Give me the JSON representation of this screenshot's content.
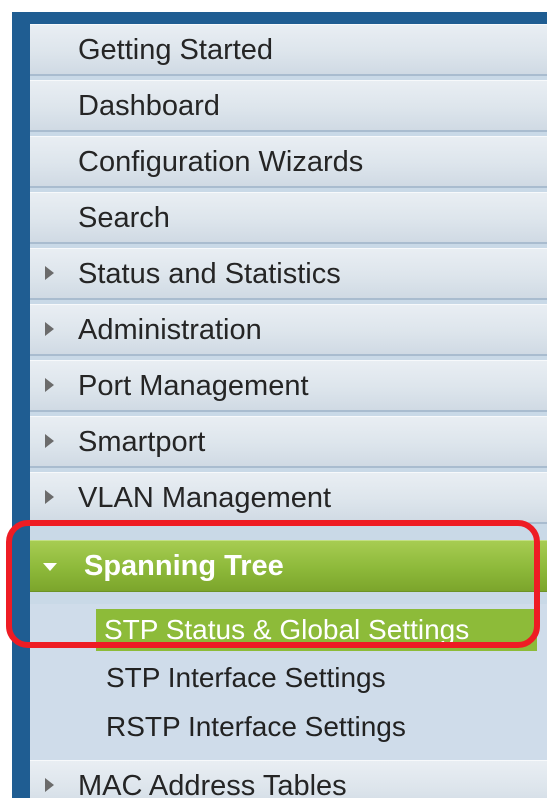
{
  "menu": {
    "items": [
      {
        "label": "Getting Started",
        "expandable": false
      },
      {
        "label": "Dashboard",
        "expandable": false
      },
      {
        "label": "Configuration Wizards",
        "expandable": false
      },
      {
        "label": "Search",
        "expandable": false
      },
      {
        "label": "Status and Statistics",
        "expandable": true
      },
      {
        "label": "Administration",
        "expandable": true
      },
      {
        "label": "Port Management",
        "expandable": true
      },
      {
        "label": "Smartport",
        "expandable": true
      },
      {
        "label": "VLAN Management",
        "expandable": true
      },
      {
        "label": "Spanning Tree",
        "expandable": true,
        "expanded": true
      },
      {
        "label": "MAC Address Tables",
        "expandable": true
      }
    ],
    "spanning_tree_submenu": [
      {
        "label": "STP Status & Global Settings",
        "selected": true
      },
      {
        "label": "STP Interface Settings",
        "selected": false
      },
      {
        "label": "RSTP Interface Settings",
        "selected": false
      }
    ]
  },
  "colors": {
    "nav_border": "#1f5d92",
    "active_green": "#8db93a",
    "highlight_red": "#ee1c24"
  }
}
